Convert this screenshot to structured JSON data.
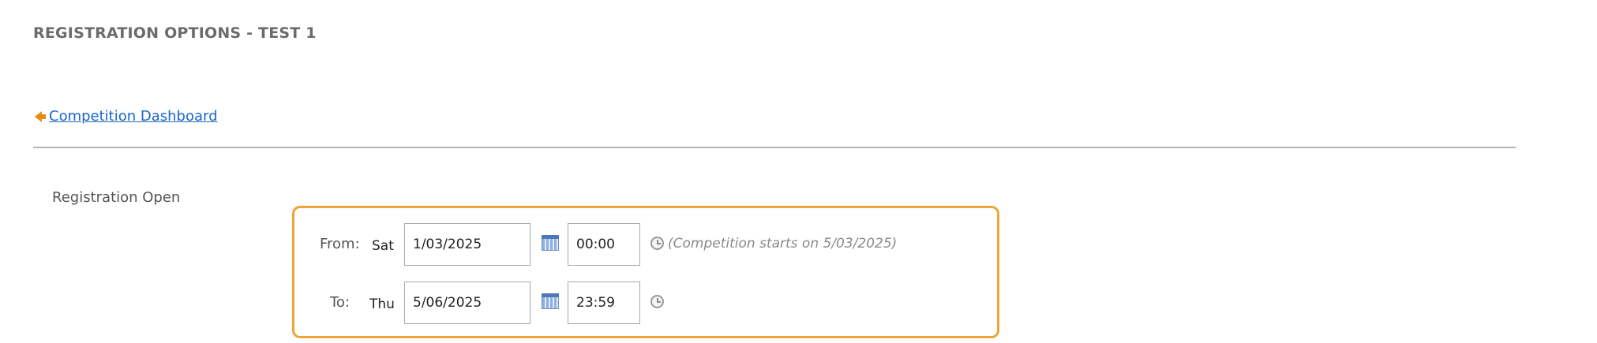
{
  "page": {
    "title": "REGISTRATION OPTIONS - TEST 1"
  },
  "navigation": {
    "back_link_label": "Competition Dashboard",
    "back_icon": "arrow-left-icon"
  },
  "registration": {
    "section_label": "Registration Open",
    "highlight_color": "#f0a33a",
    "from": {
      "label": "From:",
      "day": "Sat",
      "date": "1/03/2025",
      "time": "00:00",
      "note": "(Competition starts on 5/03/2025)"
    },
    "to": {
      "label": "To:",
      "day": "Thu",
      "date": "5/06/2025",
      "time": "23:59"
    }
  },
  "colors": {
    "link": "#1a66c8",
    "accent": "#e8891a"
  }
}
